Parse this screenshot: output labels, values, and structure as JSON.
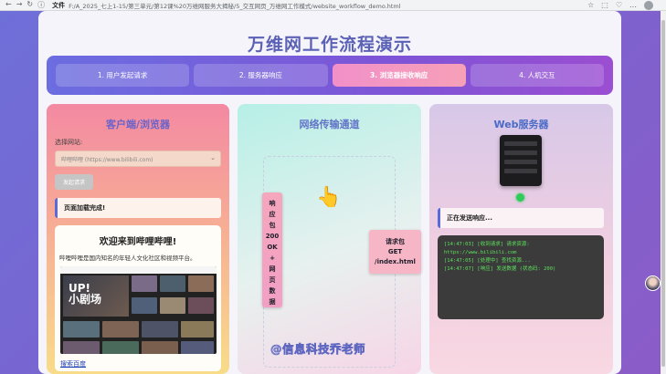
{
  "browser": {
    "nav_icons": [
      "←",
      "→",
      "↻",
      "ⓘ"
    ],
    "file_label": "文件",
    "url": "F:/A_2025_七上1-15/第三单元/第12课%20万维网服务大揭秘/5_交互网页_万维网工作模式/website_workflow_demo.html",
    "right_icons": [
      "☆",
      "⬚",
      "♡",
      "…"
    ]
  },
  "page": {
    "title": "万维网工作流程演示",
    "steps": [
      {
        "label": "1. 用户发起请求",
        "active": false
      },
      {
        "label": "2. 服务器响应",
        "active": false
      },
      {
        "label": "3. 浏览器接收响应",
        "active": true
      },
      {
        "label": "4. 人机交互",
        "active": false
      }
    ]
  },
  "client": {
    "heading": "客户端/浏览器",
    "select_label": "选择网站:",
    "select_value": "哔哩哔哩 (https://www.bilibili.com)",
    "send_button": "发起请求",
    "status": "页面加载完成!",
    "site_title": "欢迎来到哔哩哔哩!",
    "site_desc": "哔哩哔哩是国内知名的年轻人文化社区和视频平台。",
    "hero_text": "UP!\n小剧场",
    "link": "搜索百度"
  },
  "network": {
    "heading": "网络传输通道",
    "response_packet": "响\n应\n包\n200\nOK\n+\n网\n页\n数\n据",
    "request_packet_title": "请求包",
    "request_packet_method": "GET",
    "request_packet_path": "/index.html",
    "watermark": "@信息科技乔老师"
  },
  "server": {
    "heading": "Web服务器",
    "status": "正在发送响应...",
    "console": [
      "[14:47:03] [收到请求] 请求资源:",
      "https://www.bilibili.com",
      "[14:47:05] [处理中] 查找资源...",
      "[14:47:07] [响应] 发送数据 (状态码: 200)"
    ],
    "led_color": "#2fcc59"
  }
}
